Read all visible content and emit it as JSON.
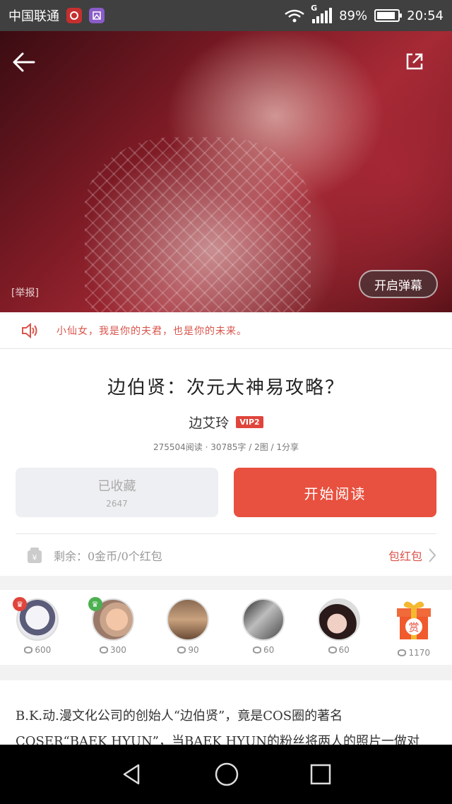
{
  "status_bar": {
    "carrier": "中国联通",
    "network": "G",
    "battery": "89%",
    "battery_level": 0.89,
    "time": "20:54"
  },
  "hero": {
    "report_label": "[举报]",
    "danmaku_label": "开启弹幕"
  },
  "notice": {
    "text": "小仙女，我是你的夫君，也是你的未来。"
  },
  "article": {
    "title": "边伯贤：次元大神易攻略？",
    "author": "边艾玲",
    "vip": "VIP2",
    "stats": "275504阅读 · 30785字 / 2图 / 1分享"
  },
  "actions": {
    "favorite_label": "已收藏",
    "favorite_count": "2647",
    "read_label": "开始阅读"
  },
  "wallet": {
    "remaining": "剩余：0金币/0个红包",
    "redpack_label": "包红包"
  },
  "supporters": [
    {
      "coins": "600",
      "badge_color": "#e0443b"
    },
    {
      "coins": "300",
      "badge_color": "#4cb050"
    },
    {
      "coins": "90"
    },
    {
      "coins": "60"
    },
    {
      "coins": "60"
    },
    {
      "coins": "1170",
      "label": "赏"
    }
  ],
  "excerpt": {
    "line1": "B.K.动.漫文化公司的创始人“边伯贤”，竟是COS圈的著名",
    "line2": "COSER“BAEK HYUN”，当BAEK HYUN的粉丝将两人的照片一做对"
  },
  "colors": {
    "accent": "#e8503f",
    "notice": "#d9534a",
    "vip": "#e0443b"
  }
}
